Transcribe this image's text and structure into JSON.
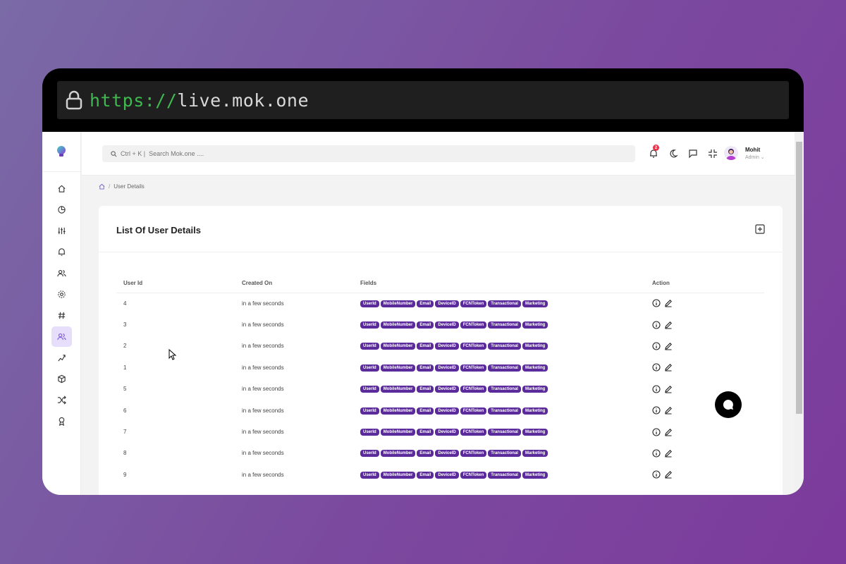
{
  "browser": {
    "url_scheme": "https://",
    "url_host": "live.mok.one"
  },
  "search": {
    "shortcut": "Ctrl + K |",
    "placeholder": "Search Mok.one ...."
  },
  "notifications": {
    "count": "2"
  },
  "user": {
    "name": "Mohit",
    "role": "Admin"
  },
  "breadcrumb": {
    "current": "User Details"
  },
  "card": {
    "title": "List Of User Details"
  },
  "table": {
    "headers": [
      "User Id",
      "Created On",
      "Fields",
      "Action"
    ],
    "fields": [
      "UserId",
      "MobileNumber",
      "Email",
      "DeviceID",
      "FCNToken",
      "Transactional",
      "Marketing"
    ],
    "rows": [
      {
        "id": "4",
        "created": "in a few seconds"
      },
      {
        "id": "3",
        "created": "in a few seconds"
      },
      {
        "id": "2",
        "created": "in a few seconds"
      },
      {
        "id": "1",
        "created": "in a few seconds"
      },
      {
        "id": "5",
        "created": "in a few seconds"
      },
      {
        "id": "6",
        "created": "in a few seconds"
      },
      {
        "id": "7",
        "created": "in a few seconds"
      },
      {
        "id": "8",
        "created": "in a few seconds"
      },
      {
        "id": "9",
        "created": "in a few seconds"
      }
    ]
  },
  "sidebar": {
    "items": [
      {
        "icon": "home-icon"
      },
      {
        "icon": "pie-chart-icon"
      },
      {
        "icon": "sliders-icon"
      },
      {
        "icon": "bell-icon"
      },
      {
        "icon": "users-icon"
      },
      {
        "icon": "gear-icon"
      },
      {
        "icon": "hash-icon"
      },
      {
        "icon": "user-group-icon",
        "active": true
      },
      {
        "icon": "chart-up-icon"
      },
      {
        "icon": "box-icon"
      },
      {
        "icon": "shuffle-icon"
      },
      {
        "icon": "award-icon"
      }
    ]
  },
  "colors": {
    "accent": "#5b2b9c",
    "active_bg": "#e6defa",
    "badge": "#e8334a"
  }
}
